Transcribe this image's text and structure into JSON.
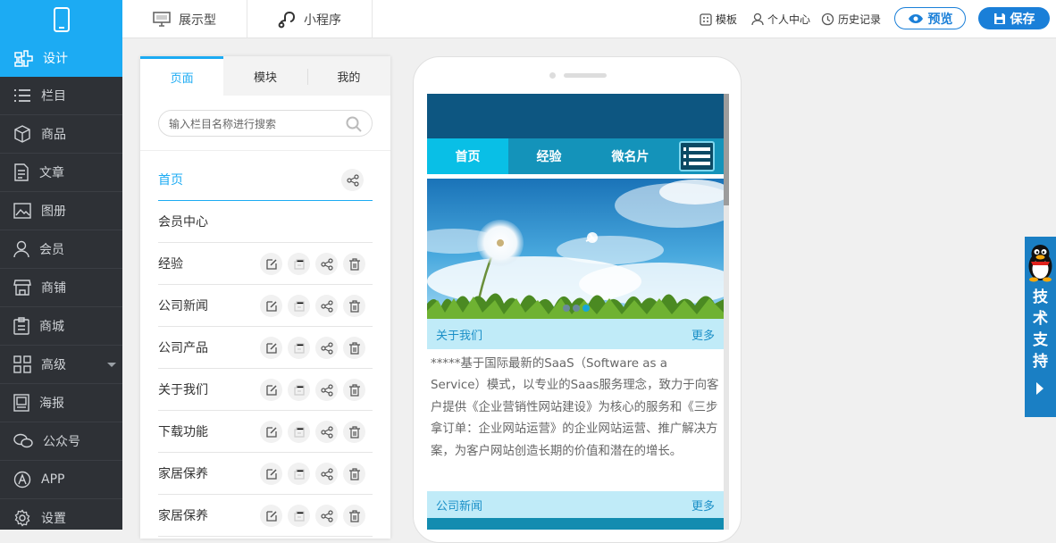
{
  "topbar": {
    "tabs": [
      {
        "label": "展示型",
        "icon": "monitor-icon"
      },
      {
        "label": "小程序",
        "icon": "miniprogram-icon"
      }
    ],
    "right": {
      "template_label": "模板",
      "user_center_label": "个人中心",
      "history_label": "历史记录",
      "preview_label": "预览",
      "save_label": "保存"
    }
  },
  "sidebar": {
    "items": [
      {
        "label": "设计",
        "icon": "design-icon",
        "active": true
      },
      {
        "label": "栏目",
        "icon": "list-icon"
      },
      {
        "label": "商品",
        "icon": "box-icon"
      },
      {
        "label": "文章",
        "icon": "article-icon"
      },
      {
        "label": "图册",
        "icon": "image-icon"
      },
      {
        "label": "会员",
        "icon": "user-icon"
      },
      {
        "label": "商铺",
        "icon": "shop-icon"
      },
      {
        "label": "商城",
        "icon": "mall-icon"
      },
      {
        "label": "高级",
        "icon": "grid-icon",
        "has_dropdown": true
      },
      {
        "label": "海报",
        "icon": "poster-icon"
      },
      {
        "label": "公众号",
        "icon": "wechat-icon"
      },
      {
        "label": "APP",
        "icon": "app-icon"
      },
      {
        "label": "设置",
        "icon": "gear-icon"
      }
    ]
  },
  "panel": {
    "tabs": [
      "页面",
      "模块",
      "我的"
    ],
    "active_tab": "页面",
    "search_placeholder": "输入栏目名称进行搜索",
    "pages": [
      "首页",
      "会员中心",
      "经验",
      "公司新闻",
      "公司产品",
      "关于我们",
      "下载功能",
      "家居保养",
      "家居保养"
    ]
  },
  "preview": {
    "nav": [
      "首页",
      "经验",
      "微名片"
    ],
    "active_nav": "首页",
    "slide_count": 3,
    "active_slide": 3,
    "about": {
      "title": "关于我们",
      "more": "更多",
      "text": "*****基于国际最新的SaaS（Software as a Service）模式，以专业的Saas服务理念，致力于向客户提供《企业营销性网站建设》为核心的服务和《三步拿订单：企业网站运营》的企业网站运营、推广解决方案，为客户网站创造长期的价值和潜在的增长。"
    },
    "news": {
      "title": "公司新闻",
      "more": "更多"
    }
  },
  "support": {
    "label_chars": [
      "技",
      "术",
      "支",
      "持"
    ]
  },
  "colors": {
    "accent": "#1cabf3",
    "sidebar_bg": "#2e3136",
    "phone_header": "#0d5681",
    "phone_nav": "#1493ba",
    "phone_nav_active": "#09bfe6",
    "section_bar": "#c0ebf8"
  }
}
